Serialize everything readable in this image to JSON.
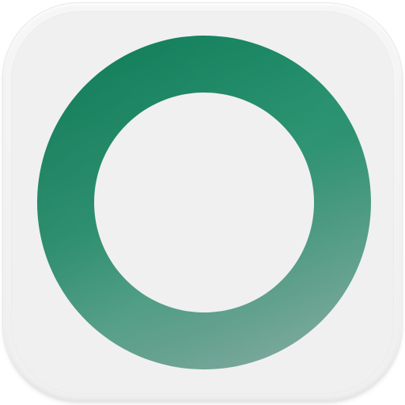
{
  "icon": {
    "name": "ring-app-icon",
    "ring_icon": "circle-ring-icon"
  },
  "colors": {
    "background": "#ffffff",
    "tile": "#f0f0f0",
    "ring_top": "#188866",
    "ring_mid": "#2f9474",
    "ring_bottom": "#72a698"
  }
}
